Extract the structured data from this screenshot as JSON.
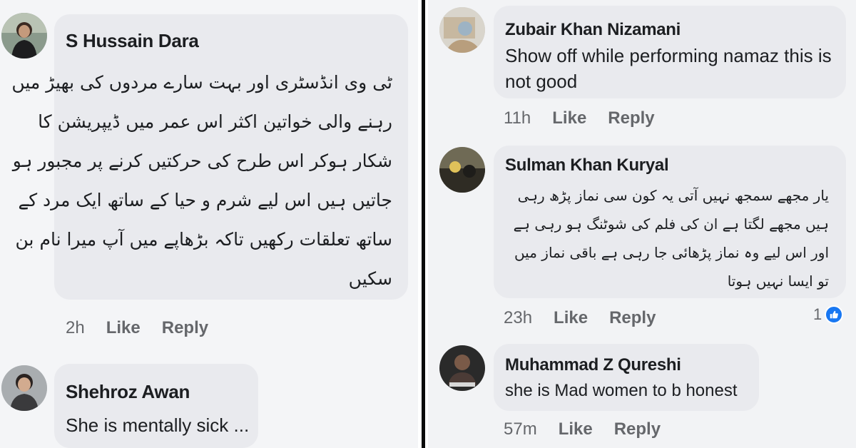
{
  "left_comments": [
    {
      "author": "S Hussain Dara",
      "lines": [
        "ٹی وی انڈسٹری اور بہت سارے مردوں کی بھیڑ میں",
        "رہنے والی خواتین اکثر اس عمر میں ڈیپریشن کا",
        "شکار ہوکر اس طرح کی حرکتیں کرنے پر مجبور ہو",
        "جاتیں ہیں اس لیے شرم و حیا کے ساتھ ایک مرد کے",
        "ساتھ تعلقات رکھیں تاکہ بڑھاپے میں آپ میرا نام بن",
        "سکیں"
      ],
      "time": "2h",
      "like": "Like",
      "reply": "Reply"
    },
    {
      "author": "Shehroz Awan",
      "text": "She is mentally sick ..."
    }
  ],
  "right_comments": [
    {
      "author": "Zubair Khan Nizamani",
      "lines": [
        "Show off while performing namaz this is",
        "not good"
      ],
      "time": "11h",
      "like": "Like",
      "reply": "Reply"
    },
    {
      "author": "Sulman Khan Kuryal",
      "lines": [
        "یار مجھے سمجھ نہیں آتی یہ کون سی نماز پڑھ رہی",
        "ہیں مجھے لگتا ہے ان کی فلم کی شوٹنگ ہو رہی ہے",
        "اور اس لیے وہ نماز پڑھائی جا رہی ہے باقی نماز میں",
        "تو ایسا نہیں ہوتا"
      ],
      "time": "23h",
      "like": "Like",
      "reply": "Reply",
      "reaction_count": "1"
    },
    {
      "author": "Muhammad Z Qureshi",
      "text": "she is Mad women to b honest",
      "time": "57m",
      "like": "Like",
      "reply": "Reply"
    }
  ],
  "colors": {
    "bubble": "#e9eaee",
    "meta_text": "#65676b",
    "like_blue": "#1877f2",
    "divider": "#0a0a0a"
  },
  "icons": {
    "reaction": "like-thumb-icon"
  }
}
